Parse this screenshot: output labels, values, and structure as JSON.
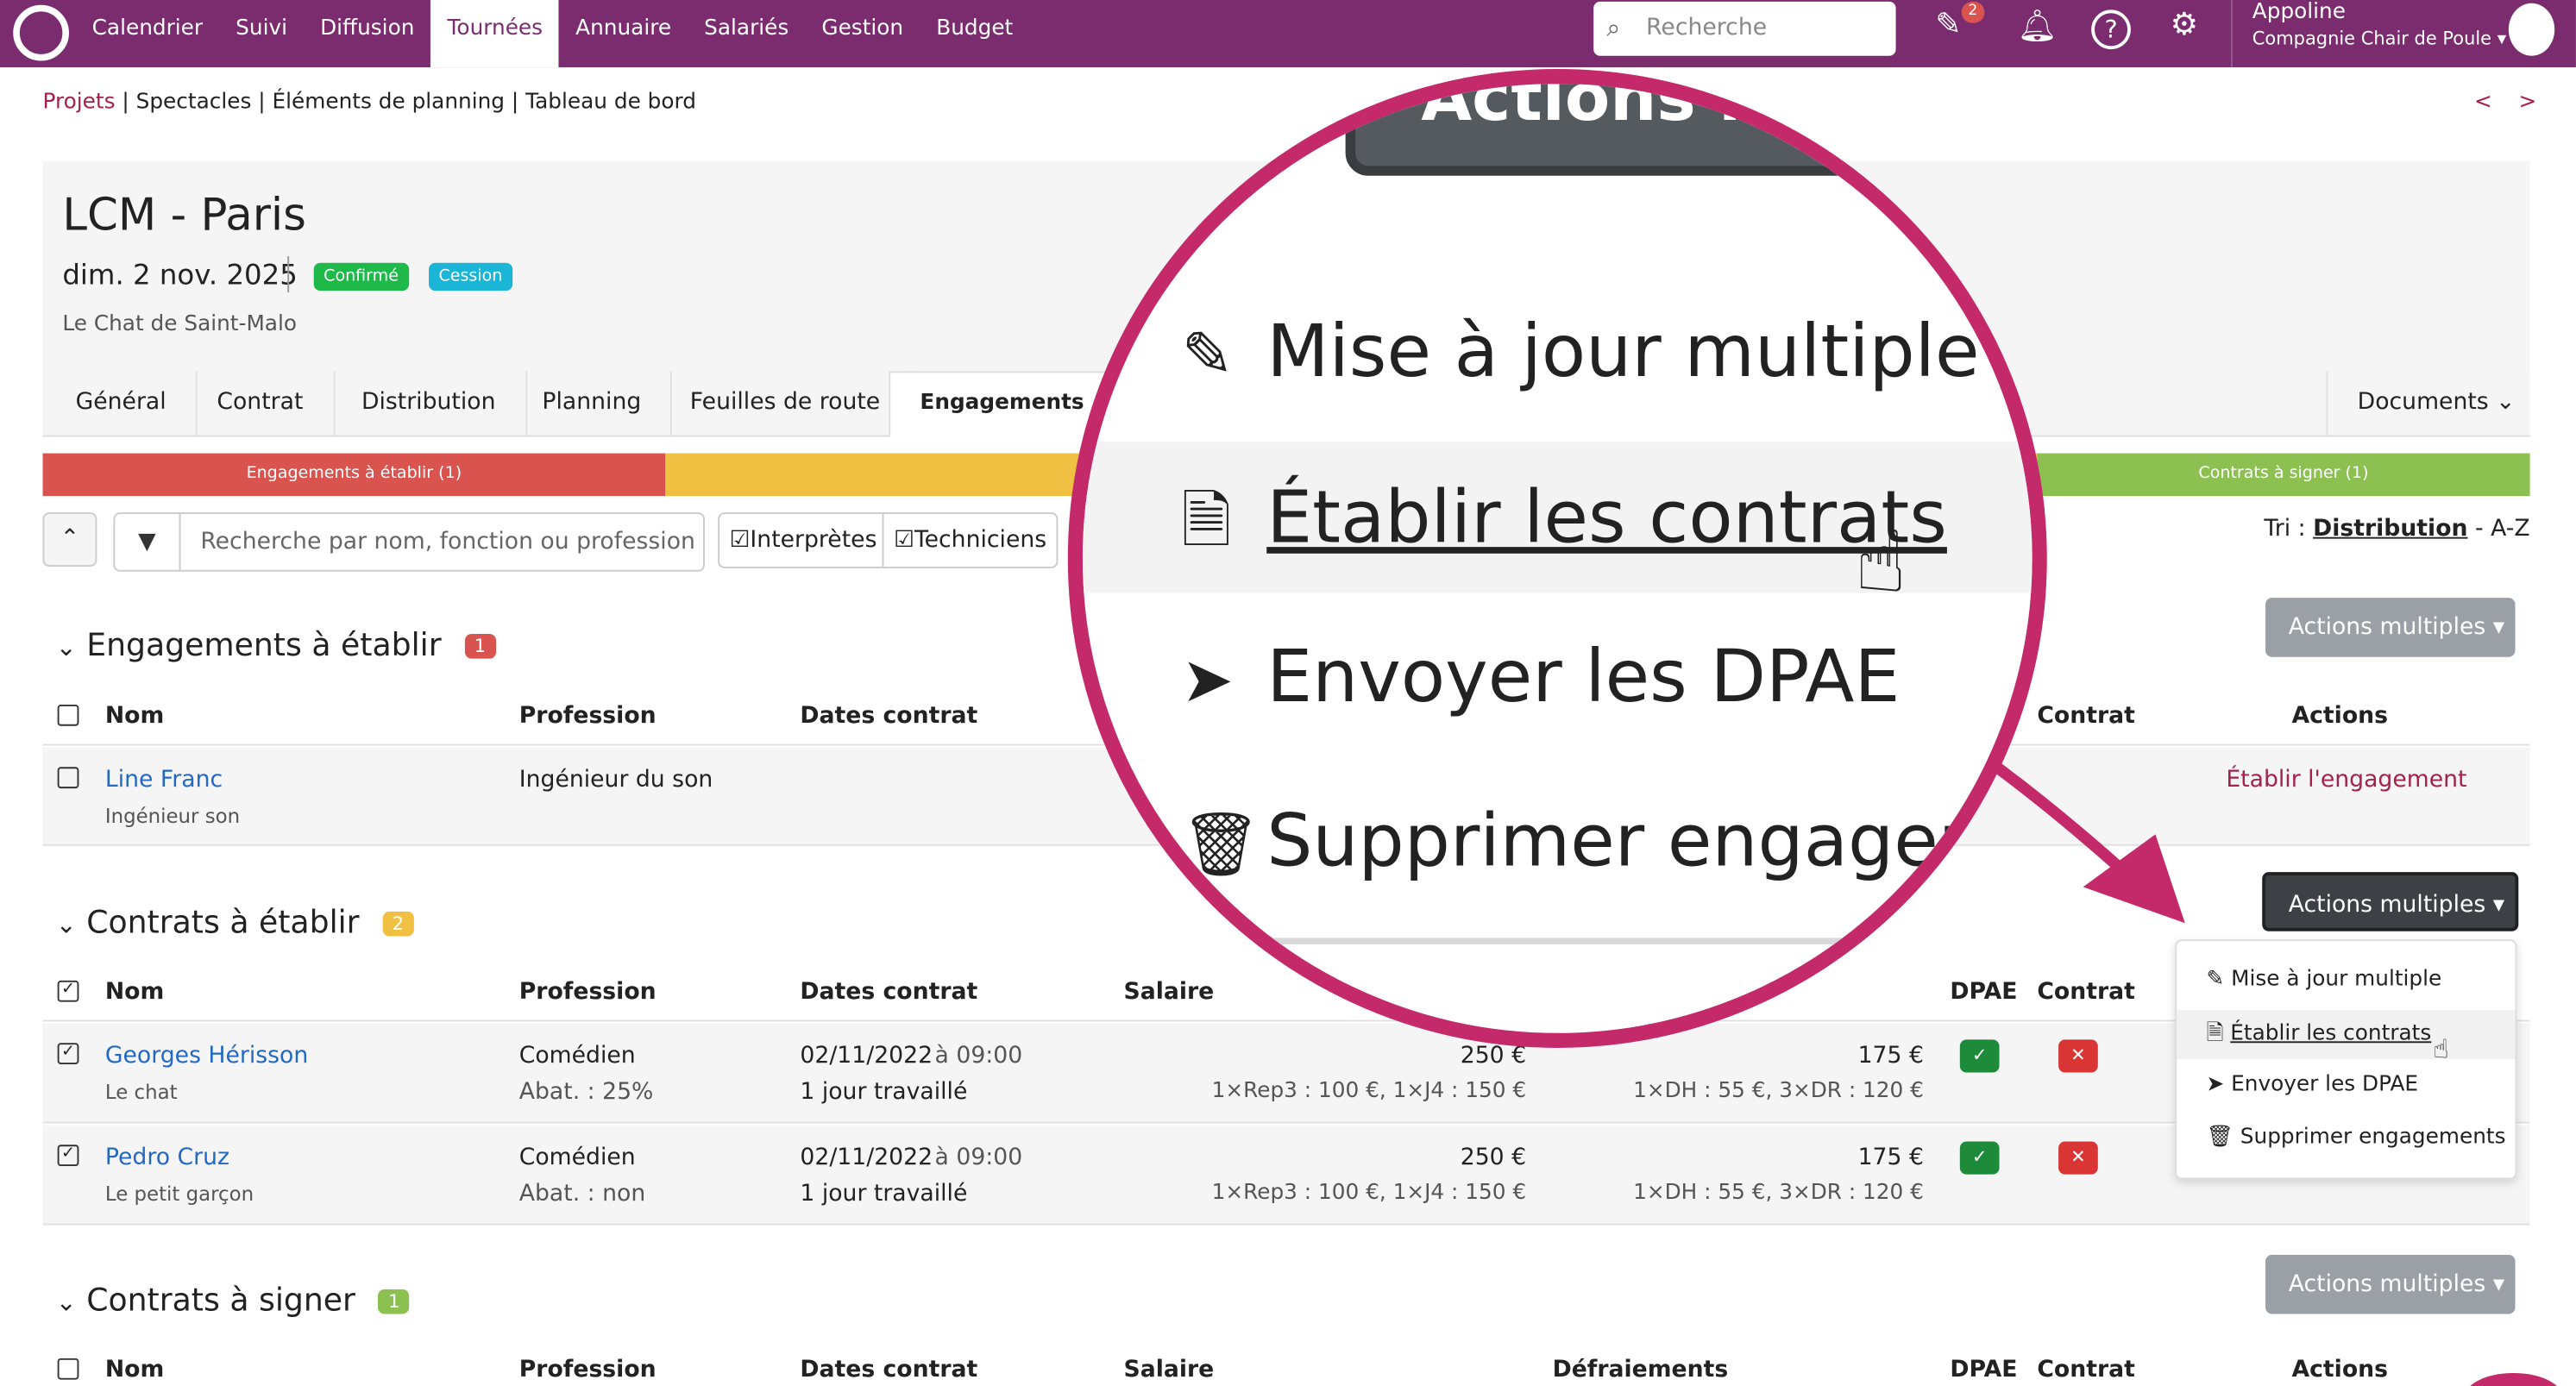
{
  "nav": {
    "menu": [
      "Calendrier",
      "Suivi",
      "Diffusion",
      "Tournées",
      "Annuaire",
      "Salariés",
      "Gestion",
      "Budget"
    ],
    "active": "Tournées",
    "search_placeholder": "Recherche",
    "notif_count": "2",
    "user_name": "Appoline",
    "user_company": "Compagnie Chair de Poule"
  },
  "breadcrumb": {
    "first": "Projets",
    "sep": " | ",
    "second": "Spectacles",
    "third": "Éléments de planning",
    "fourth": "Tableau de bord",
    "pager": "< >"
  },
  "event": {
    "title": "LCM - Paris",
    "date": "dim. 2 nov. 2025",
    "badge1": "Confirmé",
    "badge2": "Cession",
    "venue": "Le Chat de Saint-Malo"
  },
  "tabs": [
    "Général",
    "Contrat",
    "Distribution",
    "Planning",
    "Feuilles de route",
    "Engagements"
  ],
  "documents": "Documents",
  "progress": {
    "red": "Engagements à établir (1)",
    "green": "Contrats à signer (1)"
  },
  "filters": {
    "placeholder": "Recherche par nom, fonction ou profession",
    "interpretes": "Interprètes",
    "techniciens": "Techniciens",
    "tri_label": "Tri : ",
    "tri_value": "Distribution",
    "tri_suffix": " - A-Z"
  },
  "section1": {
    "title": "Engagements à établir",
    "count": "1",
    "actions": "Actions multiples",
    "headers": {
      "nom": "Nom",
      "profession": "Profession",
      "dates": "Dates contrat",
      "contrat": "Contrat",
      "actions": "Actions"
    },
    "row": {
      "name": "Line Franc",
      "role": "Ingénieur son",
      "profession": "Ingénieur du son",
      "action": "Établir l'engagement"
    }
  },
  "section2": {
    "title": "Contrats à établir",
    "count": "2",
    "actions": "Actions multiples",
    "headers": {
      "nom": "Nom",
      "profession": "Profession",
      "dates": "Dates contrat",
      "salaire": "Salaire",
      "dpae": "DPAE",
      "contrat": "Contrat"
    },
    "rows": [
      {
        "name": "Georges Hérisson",
        "role": "Le chat",
        "profession": "Comédien",
        "abat": "Abat. : 25%",
        "date": "02/11/2022",
        "time": "à 09:00",
        "days": "1 jour travaillé",
        "salaire": "250 €",
        "salaire_detail": "1×Rep3 : 100 €, 1×J4 : 150 €",
        "defr": "175 €",
        "defr_detail": "1×DH : 55 €, 3×DR : 120 €"
      },
      {
        "name": "Pedro Cruz",
        "role": "Le petit garçon",
        "profession": "Comédien",
        "abat": "Abat. : non",
        "date": "02/11/2022",
        "time": "à 09:00",
        "days": "1 jour travaillé",
        "salaire": "250 €",
        "salaire_detail": "1×Rep3 : 100 €, 1×J4 : 150 €",
        "defr": "175 €",
        "defr_detail": "1×DH : 55 €, 3×DR : 120 €"
      }
    ]
  },
  "dropdown": [
    "Mise à jour multiple",
    "Établir les contrats",
    "Envoyer les DPAE",
    "Supprimer engagements"
  ],
  "section3": {
    "title": "Contrats à signer",
    "count": "1",
    "actions": "Actions multiples",
    "headers": {
      "nom": "Nom",
      "profession": "Profession",
      "dates": "Dates contrat",
      "salaire": "Salaire",
      "defr": "Défraiements",
      "dpae": "DPAE",
      "contrat": "Contrat",
      "actions": "Actions"
    }
  },
  "magnifier": {
    "button": "Actions mu",
    "items": [
      "Mise à jour multiple",
      "Établir les contrats",
      "Envoyer les DPAE",
      "Supprimer engagemen"
    ]
  },
  "colors": {
    "brand": "#7b2c6f",
    "accent": "#c42a6a",
    "red": "#d9534f",
    "yellow": "#f0c043",
    "green": "#8cc152"
  }
}
